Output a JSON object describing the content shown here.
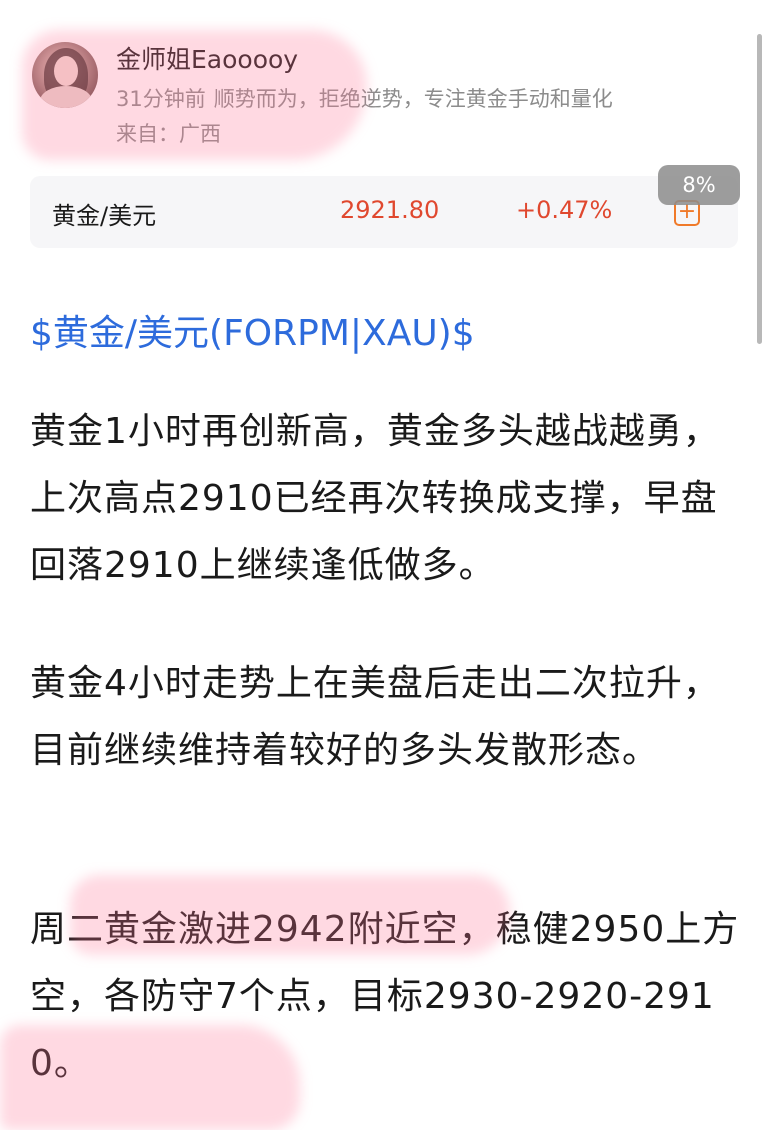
{
  "post": {
    "author": "金师姐Eaooooy",
    "time": "31分钟前",
    "bio": "顺势而为，拒绝逆势，专注黄金手动和量化",
    "location": "来自：广西"
  },
  "quote": {
    "name": "黄金/美元",
    "price": "2921.80",
    "change": "+0.47%",
    "add_icon": "+",
    "tooltip": "8%",
    "up_color": "#e0482f"
  },
  "stock_link": "$黄金/美元(FORPM|XAU)$",
  "paragraphs": [
    "黄金1小时再创新高，黄金多头越战越勇，上次高点2910已经再次转换成支撑，早盘回落2910上继续逢低做多。",
    "黄金4小时走势上在美盘后走出二次拉升，目前继续维持着较好的多头发散形态。",
    "周二黄金激进2942附近空，稳健2950上方空，各防守7个点，目标2930-2920-2910。"
  ],
  "colors": {
    "link": "#2d6bdc",
    "highlight": "#ff7896"
  }
}
